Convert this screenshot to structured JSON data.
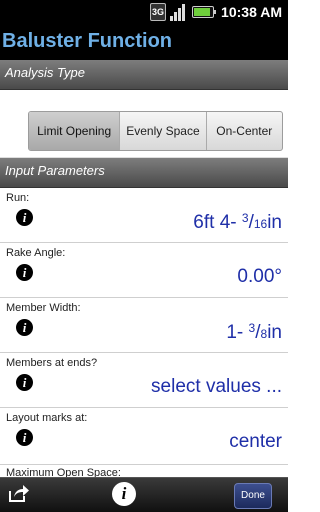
{
  "status_bar": {
    "network": "3G",
    "time": "10:38 AM"
  },
  "title": "Baluster Function",
  "analysis": {
    "header": "Analysis Type",
    "options": [
      "Limit Opening",
      "Evenly Space",
      "On-Center"
    ],
    "selected": "Limit Opening"
  },
  "parameters": {
    "header": "Input Parameters",
    "rows": [
      {
        "label": "Run:",
        "value_main": "6ft 4- ",
        "frac_num": "3",
        "frac_sep": "/",
        "frac_den": "16",
        "unit": "in"
      },
      {
        "label": "Rake Angle:",
        "value": "0.00°"
      },
      {
        "label": "Member Width:",
        "value_main": "1- ",
        "frac_num": "3",
        "frac_sep": "/",
        "frac_den": "8",
        "unit": "in"
      },
      {
        "label": "Members at ends?",
        "value": "select values ..."
      },
      {
        "label": "Layout marks at:",
        "value": "center"
      },
      {
        "label": "Maximum Open Space:"
      }
    ]
  },
  "bottom_bar": {
    "share_icon": "share-icon",
    "info_icon": "info-icon",
    "done_label": "Done"
  },
  "colors": {
    "title": "#6fb0e6",
    "value_text": "#1f2fa8",
    "done_button": "#2b3a78"
  }
}
